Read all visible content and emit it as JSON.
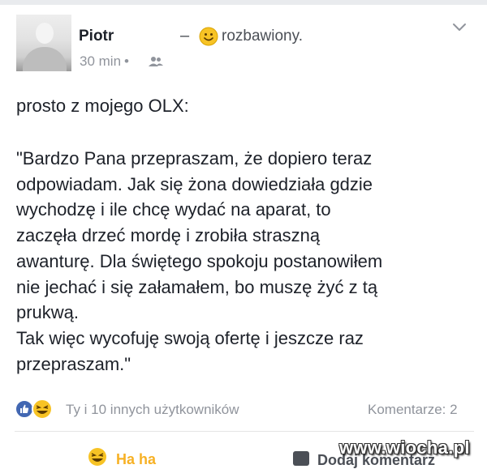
{
  "post": {
    "author": "Piotr",
    "feeling_dash": "–",
    "feeling_text": "rozbawiony.",
    "time": "30 min",
    "meta_separator": "•",
    "intro": "prosto z mojego OLX:",
    "message_lines": [
      "\"Bardzo Pana przepraszam, że dopiero teraz",
      "odpowiadam. Jak się żona dowiedziała gdzie",
      "wychodzę i ile chcę wydać na aparat, to",
      "zaczęła drzeć mordę i zrobiła straszną",
      "awanturę. Dla świętego spokoju postanowiłem",
      "nie jechać i się załamałem, bo muszę żyć z tą",
      "prukwą.",
      "Tak więc wycofuję swoją ofertę i jeszcze raz",
      "przepraszam.\""
    ]
  },
  "footer": {
    "reactions_text": "Ty i 10 innych użytkowników",
    "comments_text": "Komentarze: 2"
  },
  "actions": {
    "haha_label": "Ha ha",
    "comment_label": "Dodaj komentarz"
  },
  "watermark": "www.wiocha.pl",
  "colors": {
    "like_blue": "#4267b2",
    "haha_yellow": "#f7b125",
    "meta_grey": "#90949c",
    "text": "#1d2129"
  },
  "icons": [
    "smiley-feeling-icon",
    "chevron-down-icon",
    "friends-icon",
    "like-reaction-icon",
    "haha-reaction-icon",
    "comment-icon"
  ]
}
